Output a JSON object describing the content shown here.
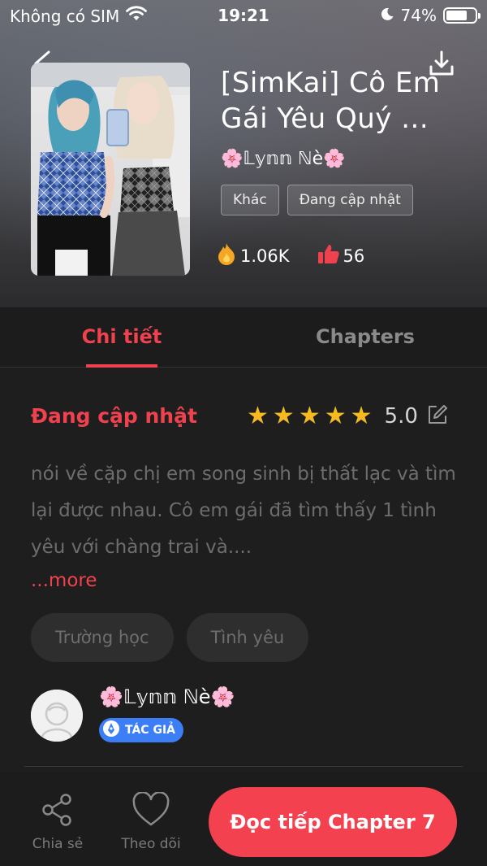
{
  "status_bar": {
    "carrier": "Không có SIM",
    "time": "19:21",
    "battery": "74%",
    "battery_level": 0.74
  },
  "story": {
    "title": "[SimKai] Cô Em Gái Yêu Quý ...",
    "author": "🌸𝕃𝕪𝕟𝕟 ℕè🌸",
    "tags": [
      "Khác",
      "Đang cập nhật"
    ],
    "views": "1.06K",
    "likes": "56"
  },
  "tabs": {
    "details": "Chi tiết",
    "chapters": "Chapters"
  },
  "details": {
    "status": "Đang cập nhật",
    "rating": "5.0",
    "stars": 5,
    "description": "nói về cặp chị em song sinh bị thất lạc và tìm lại được nhau. Cô em gái đã tìm thấy 1 tình yêu với chàng trai và....",
    "more": "...more",
    "genres": [
      "Trường học",
      "Tình yêu"
    ],
    "author_name": "🌸𝕃𝕪𝕟𝕟 ℕè🌸",
    "author_badge": "TÁC GIẢ"
  },
  "bottom_bar": {
    "share": "Chia sẻ",
    "follow": "Theo dõi",
    "continue": "Đọc tiếp Chapter 7"
  },
  "colors": {
    "accent": "#f0414f",
    "star": "#f5b921",
    "badge": "#3c7ef5",
    "background": "#1e1e1e"
  }
}
